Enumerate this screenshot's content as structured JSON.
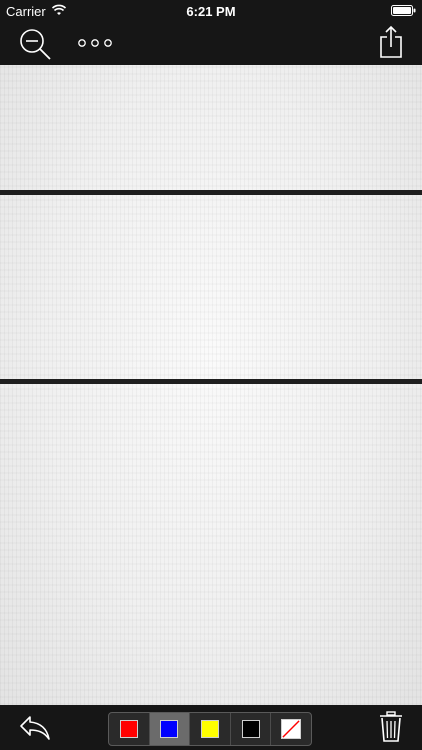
{
  "status_bar": {
    "carrier": "Carrier",
    "time": "6:21 PM",
    "icons": [
      "wifi-icon",
      "battery-icon"
    ]
  },
  "top_toolbar": {
    "left_icon": "zoom-out-icon",
    "middle_icon": "more-options-icon",
    "right_icon": "share-icon"
  },
  "canvas": {
    "panels": 3,
    "texture": "paper"
  },
  "bottom_toolbar": {
    "left_icon": "undo-icon",
    "palette": [
      {
        "name": "red",
        "color": "#ff0000",
        "selected": false
      },
      {
        "name": "blue",
        "color": "#0000ff",
        "selected": true
      },
      {
        "name": "yellow",
        "color": "#ffff00",
        "selected": false
      },
      {
        "name": "black",
        "color": "#000000",
        "selected": false
      },
      {
        "name": "eraser",
        "color": "#ffffff",
        "selected": false
      }
    ],
    "right_icon": "trash-icon"
  }
}
